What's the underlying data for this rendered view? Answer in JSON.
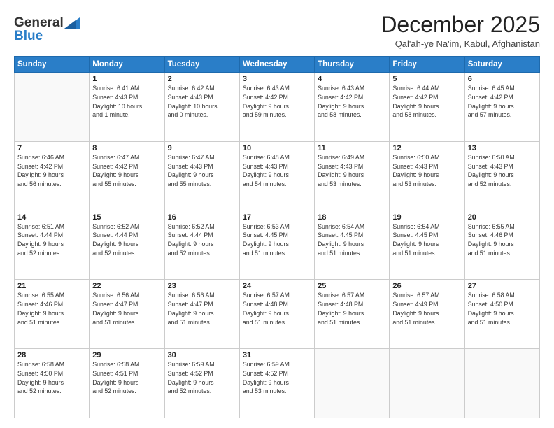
{
  "header": {
    "logo_general": "General",
    "logo_blue": "Blue",
    "month_title": "December 2025",
    "location": "Qal'ah-ye Na'im, Kabul, Afghanistan"
  },
  "days_of_week": [
    "Sunday",
    "Monday",
    "Tuesday",
    "Wednesday",
    "Thursday",
    "Friday",
    "Saturday"
  ],
  "weeks": [
    [
      {
        "day": "",
        "info": ""
      },
      {
        "day": "1",
        "info": "Sunrise: 6:41 AM\nSunset: 4:43 PM\nDaylight: 10 hours\nand 1 minute."
      },
      {
        "day": "2",
        "info": "Sunrise: 6:42 AM\nSunset: 4:43 PM\nDaylight: 10 hours\nand 0 minutes."
      },
      {
        "day": "3",
        "info": "Sunrise: 6:43 AM\nSunset: 4:42 PM\nDaylight: 9 hours\nand 59 minutes."
      },
      {
        "day": "4",
        "info": "Sunrise: 6:43 AM\nSunset: 4:42 PM\nDaylight: 9 hours\nand 58 minutes."
      },
      {
        "day": "5",
        "info": "Sunrise: 6:44 AM\nSunset: 4:42 PM\nDaylight: 9 hours\nand 58 minutes."
      },
      {
        "day": "6",
        "info": "Sunrise: 6:45 AM\nSunset: 4:42 PM\nDaylight: 9 hours\nand 57 minutes."
      }
    ],
    [
      {
        "day": "7",
        "info": "Sunrise: 6:46 AM\nSunset: 4:42 PM\nDaylight: 9 hours\nand 56 minutes."
      },
      {
        "day": "8",
        "info": "Sunrise: 6:47 AM\nSunset: 4:42 PM\nDaylight: 9 hours\nand 55 minutes."
      },
      {
        "day": "9",
        "info": "Sunrise: 6:47 AM\nSunset: 4:43 PM\nDaylight: 9 hours\nand 55 minutes."
      },
      {
        "day": "10",
        "info": "Sunrise: 6:48 AM\nSunset: 4:43 PM\nDaylight: 9 hours\nand 54 minutes."
      },
      {
        "day": "11",
        "info": "Sunrise: 6:49 AM\nSunset: 4:43 PM\nDaylight: 9 hours\nand 53 minutes."
      },
      {
        "day": "12",
        "info": "Sunrise: 6:50 AM\nSunset: 4:43 PM\nDaylight: 9 hours\nand 53 minutes."
      },
      {
        "day": "13",
        "info": "Sunrise: 6:50 AM\nSunset: 4:43 PM\nDaylight: 9 hours\nand 52 minutes."
      }
    ],
    [
      {
        "day": "14",
        "info": "Sunrise: 6:51 AM\nSunset: 4:44 PM\nDaylight: 9 hours\nand 52 minutes."
      },
      {
        "day": "15",
        "info": "Sunrise: 6:52 AM\nSunset: 4:44 PM\nDaylight: 9 hours\nand 52 minutes."
      },
      {
        "day": "16",
        "info": "Sunrise: 6:52 AM\nSunset: 4:44 PM\nDaylight: 9 hours\nand 52 minutes."
      },
      {
        "day": "17",
        "info": "Sunrise: 6:53 AM\nSunset: 4:45 PM\nDaylight: 9 hours\nand 51 minutes."
      },
      {
        "day": "18",
        "info": "Sunrise: 6:54 AM\nSunset: 4:45 PM\nDaylight: 9 hours\nand 51 minutes."
      },
      {
        "day": "19",
        "info": "Sunrise: 6:54 AM\nSunset: 4:45 PM\nDaylight: 9 hours\nand 51 minutes."
      },
      {
        "day": "20",
        "info": "Sunrise: 6:55 AM\nSunset: 4:46 PM\nDaylight: 9 hours\nand 51 minutes."
      }
    ],
    [
      {
        "day": "21",
        "info": "Sunrise: 6:55 AM\nSunset: 4:46 PM\nDaylight: 9 hours\nand 51 minutes."
      },
      {
        "day": "22",
        "info": "Sunrise: 6:56 AM\nSunset: 4:47 PM\nDaylight: 9 hours\nand 51 minutes."
      },
      {
        "day": "23",
        "info": "Sunrise: 6:56 AM\nSunset: 4:47 PM\nDaylight: 9 hours\nand 51 minutes."
      },
      {
        "day": "24",
        "info": "Sunrise: 6:57 AM\nSunset: 4:48 PM\nDaylight: 9 hours\nand 51 minutes."
      },
      {
        "day": "25",
        "info": "Sunrise: 6:57 AM\nSunset: 4:48 PM\nDaylight: 9 hours\nand 51 minutes."
      },
      {
        "day": "26",
        "info": "Sunrise: 6:57 AM\nSunset: 4:49 PM\nDaylight: 9 hours\nand 51 minutes."
      },
      {
        "day": "27",
        "info": "Sunrise: 6:58 AM\nSunset: 4:50 PM\nDaylight: 9 hours\nand 51 minutes."
      }
    ],
    [
      {
        "day": "28",
        "info": "Sunrise: 6:58 AM\nSunset: 4:50 PM\nDaylight: 9 hours\nand 52 minutes."
      },
      {
        "day": "29",
        "info": "Sunrise: 6:58 AM\nSunset: 4:51 PM\nDaylight: 9 hours\nand 52 minutes."
      },
      {
        "day": "30",
        "info": "Sunrise: 6:59 AM\nSunset: 4:52 PM\nDaylight: 9 hours\nand 52 minutes."
      },
      {
        "day": "31",
        "info": "Sunrise: 6:59 AM\nSunset: 4:52 PM\nDaylight: 9 hours\nand 53 minutes."
      },
      {
        "day": "",
        "info": ""
      },
      {
        "day": "",
        "info": ""
      },
      {
        "day": "",
        "info": ""
      }
    ]
  ]
}
